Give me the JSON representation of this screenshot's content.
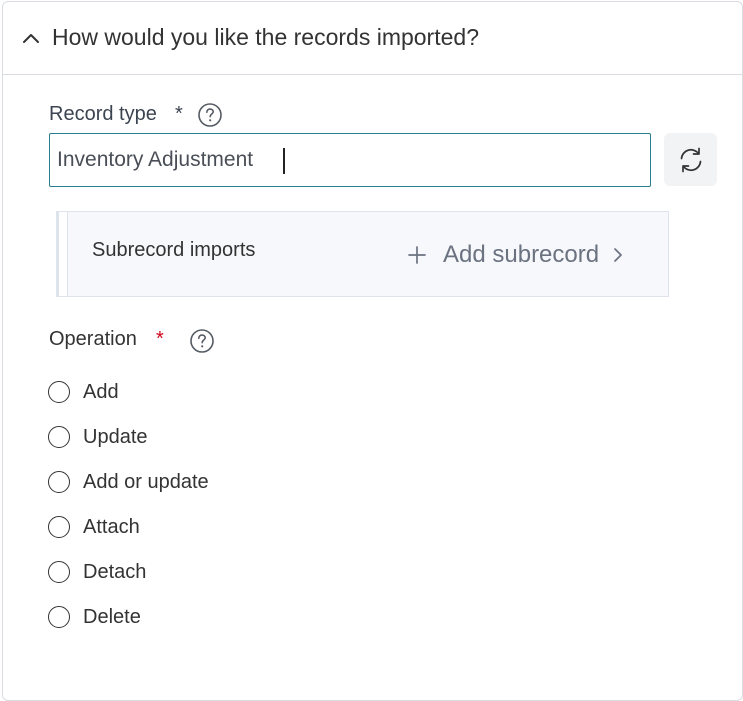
{
  "section": {
    "title": "How would you like the records imported?",
    "chevron_icon": "chevron-up-icon"
  },
  "record_type": {
    "label": "Record type",
    "required_marker": "*",
    "help_icon": "question-circle-icon",
    "value": "Inventory Adjustment",
    "refresh_icon": "refresh-icon"
  },
  "subrecord": {
    "label": "Subrecord imports",
    "add_label": "Add subrecord",
    "plus_icon": "plus-icon",
    "chevron_icon": "chevron-right-icon"
  },
  "operation": {
    "label": "Operation",
    "required_marker": "*",
    "required_color": "#d0021b",
    "help_icon": "question-circle-icon",
    "options": [
      "Add",
      "Update",
      "Add or update",
      "Attach",
      "Detach",
      "Delete"
    ]
  },
  "colors": {
    "input_border": "#2a7d8c",
    "subrecord_bg": "#f7f8fc"
  }
}
